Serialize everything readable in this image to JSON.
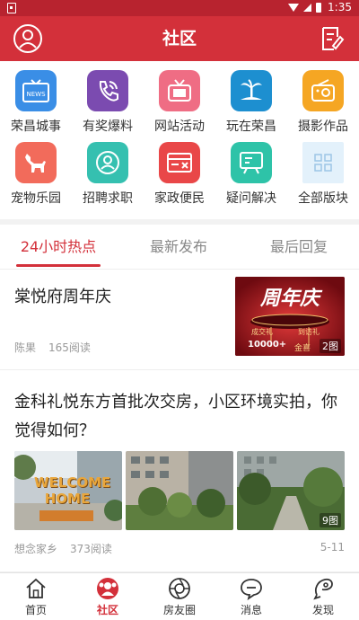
{
  "status_bar": {
    "time": "1:35"
  },
  "header": {
    "title": "社区"
  },
  "categories": [
    {
      "label": "荣昌城事",
      "icon": "news-icon",
      "color": "#3a8ee6"
    },
    {
      "label": "有奖爆料",
      "icon": "phone-icon",
      "color": "#7b4bb0"
    },
    {
      "label": "网站活动",
      "icon": "tv-icon",
      "color": "#ef6d84"
    },
    {
      "label": "玩在荣昌",
      "icon": "island-icon",
      "color": "#1d8fd0"
    },
    {
      "label": "摄影作品",
      "icon": "radio-icon",
      "color": "#f5a623"
    },
    {
      "label": "宠物乐园",
      "icon": "dog-icon",
      "color": "#f26b5b"
    },
    {
      "label": "招聘求职",
      "icon": "person-icon",
      "color": "#35c0b0"
    },
    {
      "label": "家政便民",
      "icon": "card-icon",
      "color": "#e94748"
    },
    {
      "label": "疑问解决",
      "icon": "board-icon",
      "color": "#2ec3a8"
    },
    {
      "label": "全部版块",
      "icon": "grid-icon",
      "color": "#e3f1fb"
    }
  ],
  "tabs": [
    {
      "label": "24小时热点",
      "active": true
    },
    {
      "label": "最新发布",
      "active": false
    },
    {
      "label": "最后回复",
      "active": false
    }
  ],
  "posts": [
    {
      "title": "棠悦府周年庆",
      "author": "陈果",
      "reads": "165阅读",
      "image_count": "2图",
      "thumb_text": {
        "headline": "周年庆",
        "left": "成交礼",
        "right": "到访礼",
        "amount": "10000+",
        "gift": "金喜"
      }
    },
    {
      "title": "金科礼悦东方首批次交房，小区环境实拍，你觉得如何？",
      "author": "想念家乡",
      "reads": "373阅读",
      "date": "5-11",
      "image_count": "9图",
      "img1_text": "WELCOME HOME"
    }
  ],
  "bottom_nav": [
    {
      "label": "首页",
      "icon": "home-icon",
      "active": false
    },
    {
      "label": "社区",
      "icon": "community-icon",
      "active": true
    },
    {
      "label": "房友圈",
      "icon": "friends-circle-icon",
      "active": false
    },
    {
      "label": "消息",
      "icon": "message-icon",
      "active": false
    },
    {
      "label": "发现",
      "icon": "discover-icon",
      "active": false
    }
  ],
  "colors": {
    "brand_red": "#d3303a",
    "status_red": "#b8232f"
  }
}
